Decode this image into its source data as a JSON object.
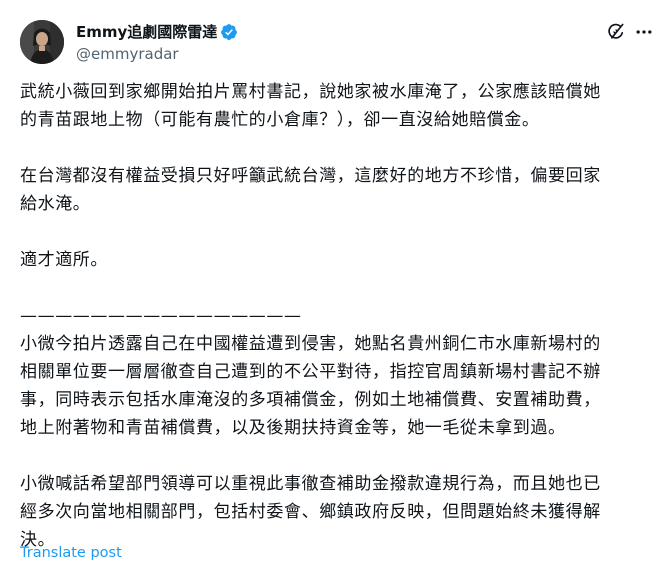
{
  "author": {
    "display_name": "Emmy追劇國際雷達",
    "handle": "@emmyradar",
    "verified": true,
    "avatar_icon": "user-avatar"
  },
  "actions": {
    "grok_icon": "grok-icon",
    "more_icon": "more-icon"
  },
  "tweet": {
    "lines": [
      "武統小薇回到家鄉開始拍片罵村書記，說她家被水庫淹了，公家應該賠償她",
      "的青苗跟地上物（可能有農忙的小倉庫？），卻一直沒給她賠償金。",
      "",
      "在台灣都沒有權益受損只好呼籲武統台灣，這麼好的地方不珍惜，偏要回家",
      "給水淹。",
      "",
      "適才適所。",
      "",
      "————————————————",
      "小微今拍片透露自己在中國權益遭到侵害，她點名貴州銅仁市水庫新場村的",
      "相關單位要一層層徹查自己遭到的不公平對待，指控官周鎮新場村書記不辦",
      "事，同時表示包括水庫淹沒的多項補償金，例如土地補償費、安置補助費，",
      "地上附著物和青苗補償費，以及後期扶持資金等，她一毛從未拿到過。",
      "",
      "小微喊話希望部門領導可以重視此事徹查補助金撥款違規行為，而且她也已",
      "經多次向當地相關部門，包括村委會、鄉鎮政府反映，但問題始終未獲得解",
      "決。"
    ]
  },
  "footer": {
    "translate_label": "Translate post"
  },
  "colors": {
    "text": "#0f1419",
    "secondary": "#536471",
    "link": "#1d9bf0",
    "verified": "#1d9bf0"
  }
}
